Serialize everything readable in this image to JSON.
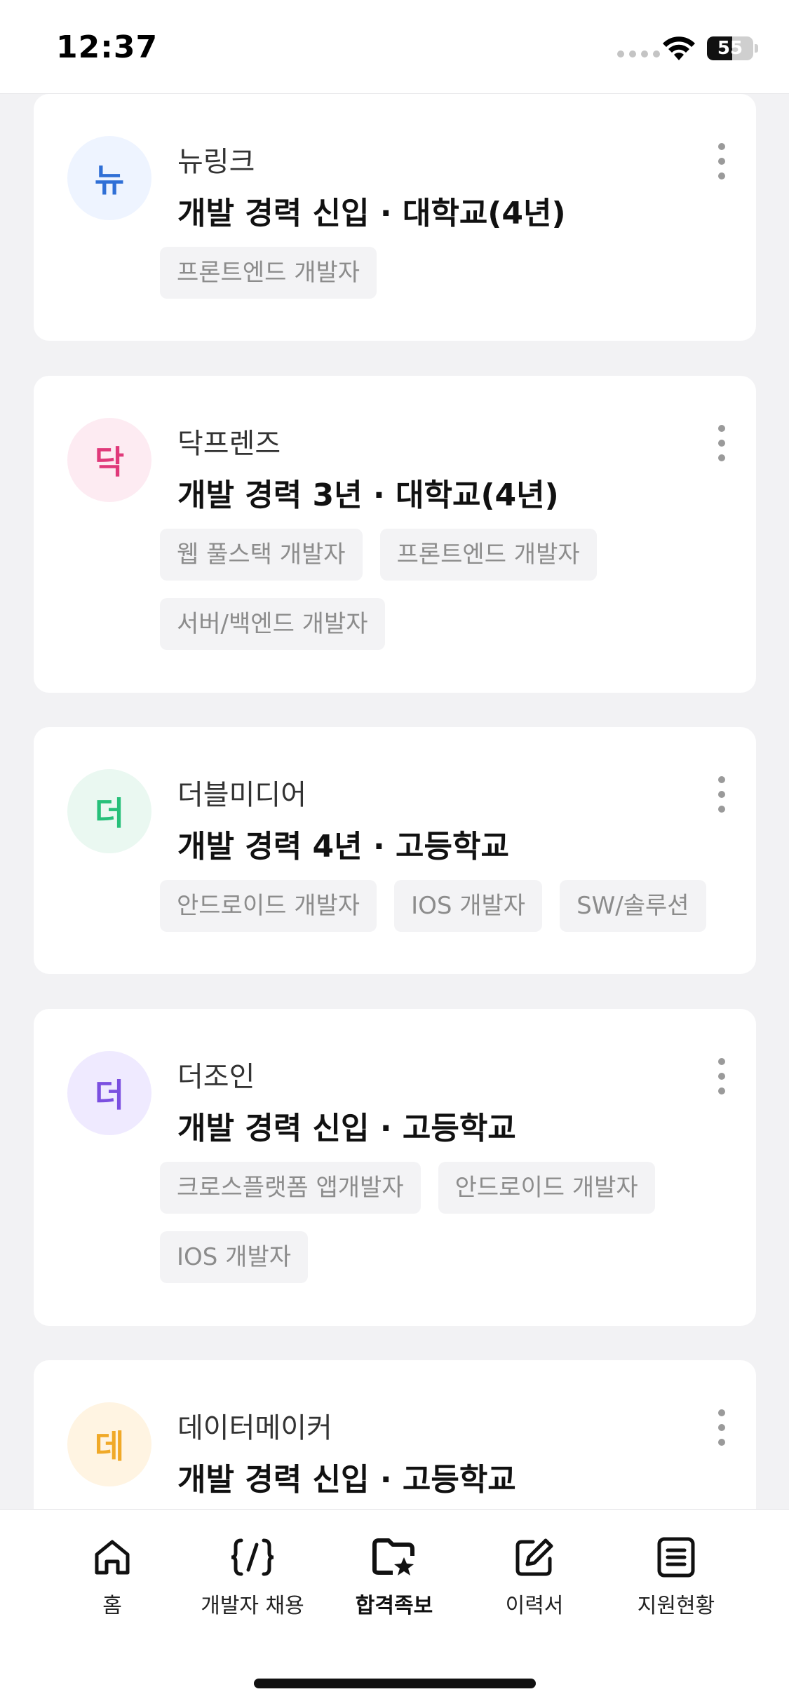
{
  "status_bar": {
    "time": "12:37",
    "battery": "55"
  },
  "cards": [
    {
      "company": "뉴링크",
      "avatar_char": "뉴",
      "avatar_color": "#2f6fd6",
      "avatar_bg": "#eef4ff",
      "headline": "개발 경력 신입 · 대학교(4년)",
      "tags": [
        "프론트엔드 개발자"
      ]
    },
    {
      "company": "닥프렌즈",
      "avatar_char": "닥",
      "avatar_color": "#e0397a",
      "avatar_bg": "#fdebf2",
      "headline": "개발 경력 3년 · 대학교(4년)",
      "tags": [
        "웹 풀스택 개발자",
        "프론트엔드 개발자",
        "서버/백엔드 개발자"
      ]
    },
    {
      "company": "더블미디어",
      "avatar_char": "더",
      "avatar_color": "#27c07a",
      "avatar_bg": "#eaf8f1",
      "headline": "개발 경력 4년 · 고등학교",
      "tags": [
        "안드로이드 개발자",
        "IOS 개발자",
        "SW/솔루션"
      ]
    },
    {
      "company": "더조인",
      "avatar_char": "더",
      "avatar_color": "#7b4fe0",
      "avatar_bg": "#efeaff",
      "headline": "개발 경력 신입 · 고등학교",
      "tags": [
        "크로스플랫폼 앱개발자",
        "안드로이드 개발자",
        "IOS 개발자"
      ]
    },
    {
      "company": "데이터메이커",
      "avatar_char": "데",
      "avatar_color": "#f0a928",
      "avatar_bg": "#fff4e2",
      "headline": "개발 경력 신입 · 고등학교",
      "tags": []
    }
  ],
  "tab_bar": {
    "items": [
      {
        "label": "홈",
        "icon": "home-icon"
      },
      {
        "label": "개발자 채용",
        "icon": "code-icon"
      },
      {
        "label": "합격족보",
        "icon": "star-folder-icon",
        "active": true
      },
      {
        "label": "이력서",
        "icon": "edit-icon"
      },
      {
        "label": "지원현황",
        "icon": "list-icon"
      }
    ]
  }
}
